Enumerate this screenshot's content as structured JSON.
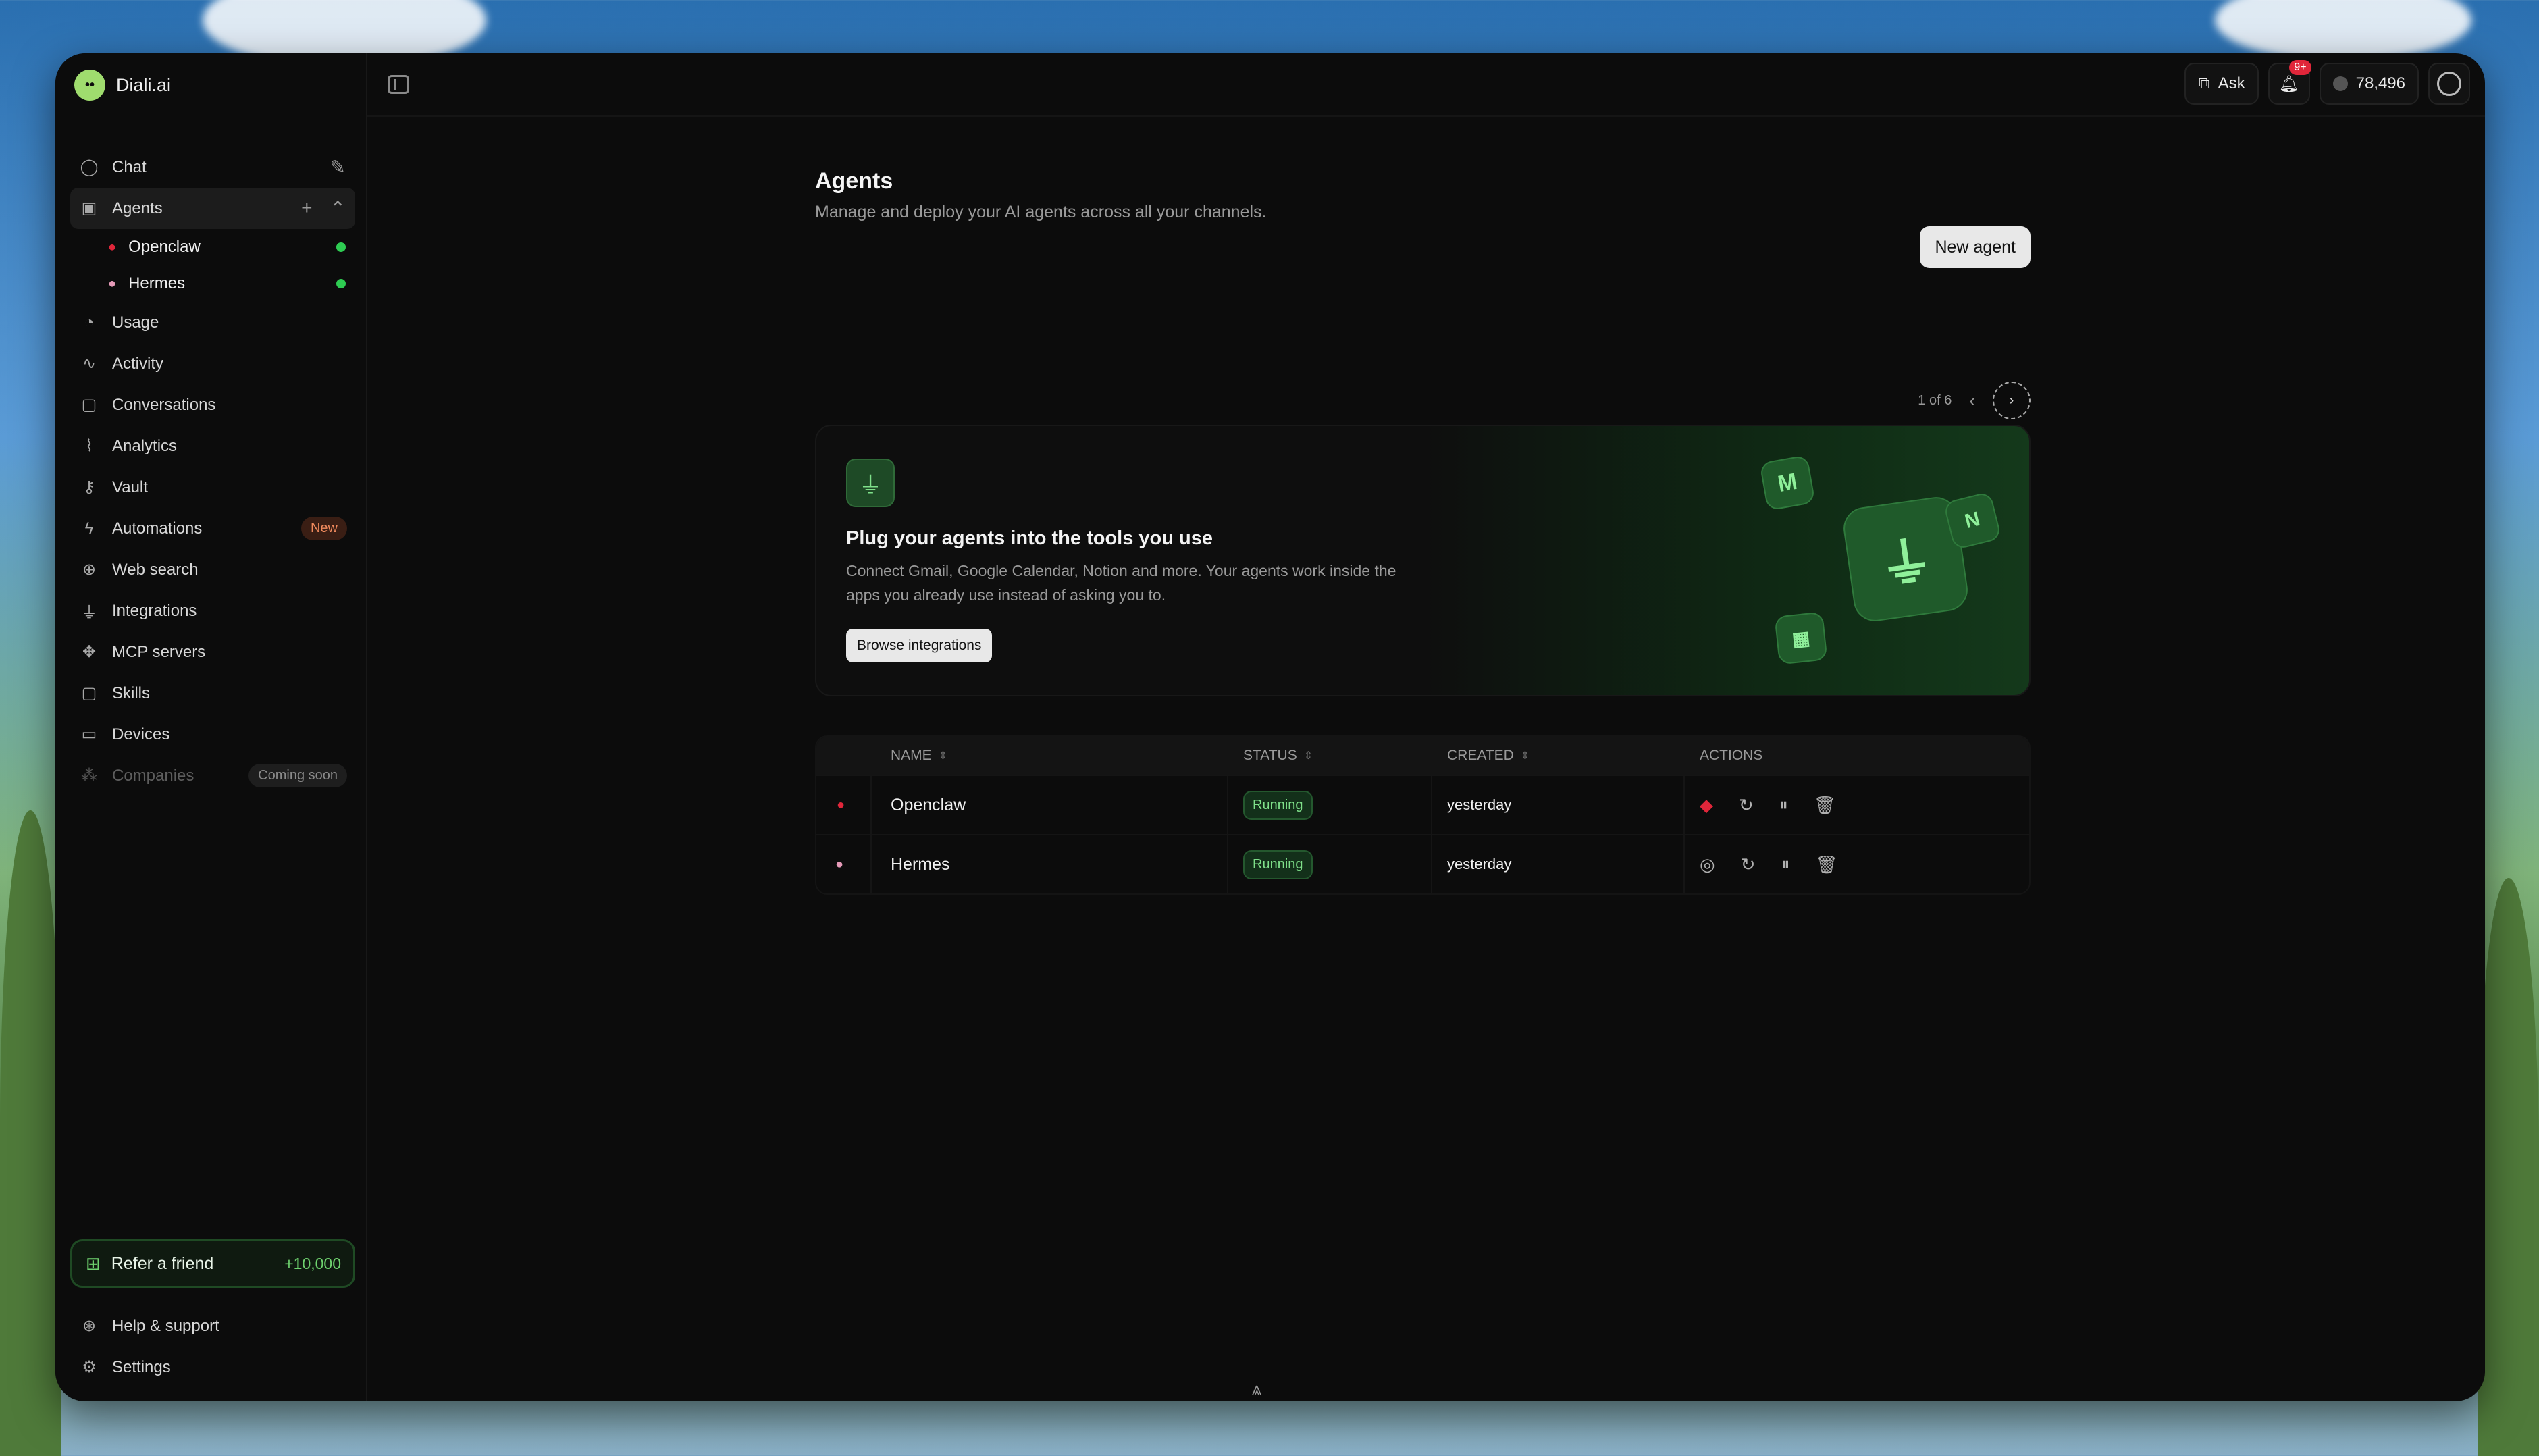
{
  "brand": {
    "name": "Diali.ai"
  },
  "topbar": {
    "ask_label": "Ask",
    "notif_badge": "9+",
    "credits": "78,496"
  },
  "sidebar": {
    "items": [
      {
        "label": "Chat",
        "icon": "chat-bubble-icon"
      },
      {
        "label": "Agents",
        "icon": "agents-icon"
      },
      {
        "label": "Usage",
        "icon": "usage-icon"
      },
      {
        "label": "Activity",
        "icon": "pulse-icon"
      },
      {
        "label": "Conversations",
        "icon": "conversations-icon"
      },
      {
        "label": "Analytics",
        "icon": "analytics-icon"
      },
      {
        "label": "Vault",
        "icon": "key-icon"
      },
      {
        "label": "Automations",
        "icon": "bolt-icon",
        "badge": "New"
      },
      {
        "label": "Web search",
        "icon": "globe-icon"
      },
      {
        "label": "Integrations",
        "icon": "plug-icon"
      },
      {
        "label": "MCP servers",
        "icon": "mcp-icon"
      },
      {
        "label": "Skills",
        "icon": "skills-icon"
      },
      {
        "label": "Devices",
        "icon": "devices-icon"
      },
      {
        "label": "Companies",
        "icon": "companies-icon",
        "badge": "Coming soon"
      }
    ],
    "agents": [
      {
        "label": "Openclaw"
      },
      {
        "label": "Hermes"
      }
    ],
    "refer": {
      "label": "Refer a friend",
      "bonus": "+10,000"
    },
    "bottom": [
      {
        "label": "Help & support"
      },
      {
        "label": "Settings"
      }
    ]
  },
  "main": {
    "title": "Agents",
    "subtitle": "Manage and deploy your AI agents across all your channels.",
    "new_agent_label": "New agent",
    "pager": "1 of 6",
    "promo": {
      "title": "Plug your agents into the tools you use",
      "description": "Connect Gmail, Google Calendar, Notion and more. Your agents work inside the apps you already use instead of asking you to.",
      "button": "Browse integrations"
    },
    "table": {
      "headers": [
        "NAME",
        "STATUS",
        "CREATED",
        "ACTIONS"
      ],
      "rows": [
        {
          "name": "Openclaw",
          "status": "Running",
          "created": "yesterday"
        },
        {
          "name": "Hermes",
          "status": "Running",
          "created": "yesterday"
        }
      ]
    }
  },
  "colors": {
    "accent_green": "#2ecc52",
    "running_text": "#7fe08a",
    "new_badge": "#f08a5d",
    "notif": "#e0263a"
  }
}
